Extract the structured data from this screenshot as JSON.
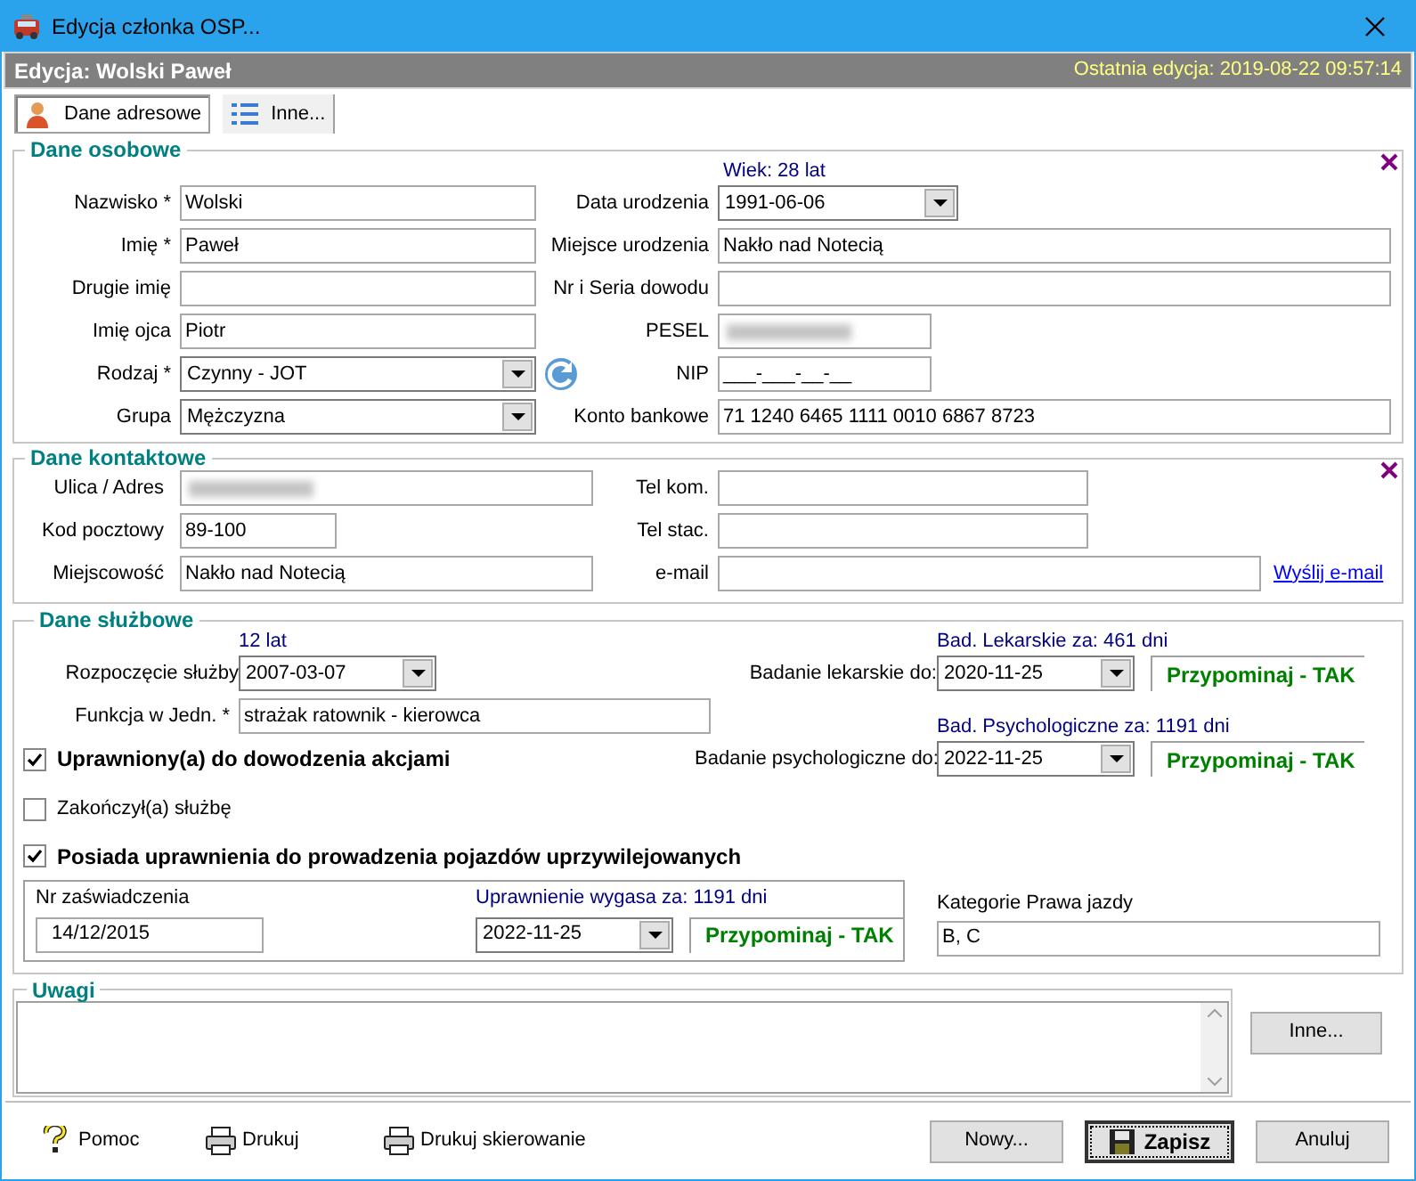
{
  "window": {
    "title": "Edycja członka OSP..."
  },
  "header": {
    "title": "Edycja: Wolski Paweł",
    "last_edit": "Ostatnia edycja: 2019-08-22 09:57:14"
  },
  "tabs": [
    {
      "label": "Dane adresowe",
      "selected": true,
      "kind": "person"
    },
    {
      "label": "Inne...",
      "selected": false,
      "kind": "list"
    }
  ],
  "personal": {
    "title": "Dane osobowe",
    "age": "Wiek: 28 lat",
    "left_fields": [
      {
        "label": "Nazwisko *",
        "value": "Wolski",
        "kind": "text"
      },
      {
        "label": "Imię *",
        "value": "Paweł",
        "kind": "text"
      },
      {
        "label": "Drugie imię",
        "kind": "text"
      },
      {
        "label": "Imię ojca",
        "value": "Piotr",
        "kind": "text"
      },
      {
        "label": "Rodzaj *",
        "value": "Czynny - JOT",
        "kind": "dropdown"
      },
      {
        "label": "Grupa",
        "value": "Mężczyzna",
        "kind": "dropdown"
      }
    ],
    "right_fields": [
      {
        "label": "Data urodzenia",
        "value": "1991-06-06",
        "kind": "date"
      },
      {
        "label": "Miejsce urodzenia",
        "value": "Nakło nad Notecią",
        "kind": "text"
      },
      {
        "label": "Nr i Seria dowodu",
        "kind": "text"
      },
      {
        "label": "PESEL",
        "kind": "redacted"
      },
      {
        "label": "NIP",
        "value": "___-___-__-__",
        "kind": "short"
      },
      {
        "label": "Konto bankowe",
        "value": "71 1240 6465 1111 0010 6867 8723",
        "kind": "text"
      }
    ]
  },
  "contact": {
    "title": "Dane kontaktowe",
    "left_fields": [
      {
        "label": "Ulica / Adres",
        "kind": "redacted"
      },
      {
        "label": "Kod pocztowy",
        "value": "89-100",
        "kind": "short"
      },
      {
        "label": "Miejscowość",
        "value": "Nakło nad Notecią",
        "kind": "text"
      }
    ],
    "right_fields": [
      {
        "label": "Tel kom.",
        "kind": "text"
      },
      {
        "label": "Tel stac.",
        "kind": "text"
      },
      {
        "label": "e-mail",
        "kind": "wide"
      }
    ],
    "email_link": "Wyślij e-mail"
  },
  "service": {
    "title": "Dane służbowe",
    "years": "12 lat",
    "start": {
      "label": "Rozpoczęcie służby",
      "value": "2007-03-07"
    },
    "function": {
      "label": "Funkcja w Jedn. *",
      "value": "strażak ratownik - kierowca"
    },
    "command": {
      "label": "Uprawniony(a) do dowodzenia akcjami",
      "checked": true
    },
    "ended": {
      "label": "Zakończył(a) służbę",
      "checked": false
    },
    "exams": [
      {
        "note": "Bad. Lekarskie za: 461 dni",
        "label": "Badanie lekarskie do:",
        "value": "2020-11-25",
        "reminder": "Przypominaj - TAK"
      },
      {
        "note": "Bad. Psychologiczne za: 1191 dni",
        "label": "Badanie psychologiczne do:",
        "value": "2022-11-25",
        "reminder": "Przypominaj - TAK"
      }
    ],
    "privileged": {
      "label": "Posiada uprawnienia do prowadzenia pojazdów uprzywilejowanych",
      "checked": true
    },
    "license": {
      "cert_label": "Nr zaświadczenia",
      "cert_value": "14/12/2015",
      "expiry_note": "Uprawnienie wygasa za: 1191 dni",
      "expiry_value": "2022-11-25",
      "reminder": "Przypominaj - TAK",
      "categories_label": "Kategorie Prawa jazdy",
      "categories_value": "B, C"
    }
  },
  "notes": {
    "title": "Uwagi",
    "button": "Inne..."
  },
  "footer": {
    "links": [
      {
        "label": "Pomoc",
        "kind": "help"
      },
      {
        "label": "Drukuj",
        "kind": "print"
      },
      {
        "label": "Drukuj skierowanie",
        "kind": "print"
      }
    ],
    "buttons": [
      {
        "label": "Nowy...",
        "kind": "plain"
      },
      {
        "label": "Zapisz",
        "kind": "save"
      },
      {
        "label": "Anuluj",
        "kind": "plain"
      }
    ]
  }
}
